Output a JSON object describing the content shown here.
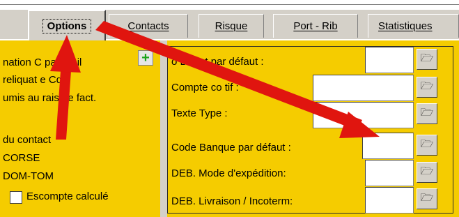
{
  "tabs": [
    {
      "label": "Options",
      "active": true
    },
    {
      "label": "Contacts",
      "active": false
    },
    {
      "label": "Risque",
      "active": false
    },
    {
      "label": "Port - Rib",
      "active": false
    },
    {
      "label": "Statistiques",
      "active": false
    }
  ],
  "left_panel": {
    "line1": "nation C    par Mail",
    "line2": "reliquat    e Cde",
    "line3": "umis au    rais de fact.",
    "line4": "du contact",
    "line5": "CORSE",
    "line6": "DOM-TOM",
    "checkbox_label": "Escompte calculé"
  },
  "fields": [
    {
      "label": "     o Dépot par défaut :",
      "value": ""
    },
    {
      "label": "Compte co      tif :",
      "value": ""
    },
    {
      "label": "Texte Type :",
      "value": ""
    },
    {
      "label": "Code Banque par défaut :",
      "value": ""
    },
    {
      "label": "DEB. Mode d'expédition:",
      "value": ""
    },
    {
      "label": "DEB. Livraison / Incoterm:",
      "value": ""
    }
  ],
  "icons": {
    "add": "plus-icon",
    "folder": "open-folder-icon",
    "annotation": "red-arrow"
  },
  "colors": {
    "panel": "#f5cc00",
    "arrow": "#e0150f",
    "tab_bg": "#d4d0c8"
  }
}
